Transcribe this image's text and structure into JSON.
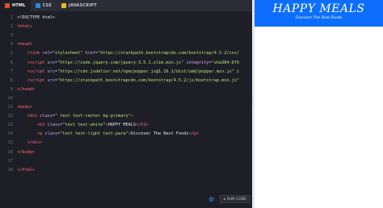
{
  "tabs": [
    {
      "label": "HTML",
      "active": true
    },
    {
      "label": "CSS",
      "active": false
    },
    {
      "label": "JAVASCRIPT",
      "active": false
    }
  ],
  "code_lines": [
    {
      "n": "1",
      "parts": [
        [
          "plain",
          "<!DOCTYPE html>"
        ]
      ]
    },
    {
      "n": "2",
      "parts": [
        [
          "tag",
          "<html>"
        ]
      ]
    },
    {
      "n": "3",
      "parts": []
    },
    {
      "n": "4",
      "parts": [
        [
          "tag",
          "<head>"
        ]
      ]
    },
    {
      "n": "5",
      "parts": [
        [
          "plain",
          "    "
        ],
        [
          "tag",
          "<link "
        ],
        [
          "attr",
          "rel="
        ],
        [
          "str",
          "\"stylesheet\""
        ],
        [
          "attr",
          " href="
        ],
        [
          "str",
          "\"https://stackpath.bootstrapcdn.com/bootstrap/4.5.2/css/"
        ]
      ]
    },
    {
      "n": "6",
      "parts": [
        [
          "plain",
          "    "
        ],
        [
          "tag",
          "<script "
        ],
        [
          "attr",
          "src="
        ],
        [
          "str",
          "\"https://code.jquery.com/jquery-3.5.1.slim.min.js\""
        ],
        [
          "attr",
          " integrity="
        ],
        [
          "str",
          "\"sha384-DfX"
        ]
      ]
    },
    {
      "n": "7",
      "parts": [
        [
          "plain",
          "    "
        ],
        [
          "tag",
          "<script "
        ],
        [
          "attr",
          "src="
        ],
        [
          "str",
          "\"https://cdn.jsdelivr.net/npm/popper.js@1.16.1/dist/umd/popper.min.js\" i"
        ]
      ]
    },
    {
      "n": "8",
      "parts": [
        [
          "plain",
          "    "
        ],
        [
          "tag",
          "<script "
        ],
        [
          "attr",
          "src="
        ],
        [
          "str",
          "\"https://stackpath.bootstrapcdn.com/bootstrap/4.5.2/js/bootstrap.min.js\""
        ]
      ]
    },
    {
      "n": "9",
      "parts": [
        [
          "tag",
          "</head>"
        ]
      ]
    },
    {
      "n": "10",
      "parts": []
    },
    {
      "n": "11",
      "parts": [
        [
          "tag",
          "<body>"
        ]
      ]
    },
    {
      "n": "12",
      "parts": [
        [
          "plain",
          "    "
        ],
        [
          "tag",
          "<div "
        ],
        [
          "attr",
          "class="
        ],
        [
          "str",
          "\" text text-center bg-primary\""
        ],
        [
          "tag",
          ">"
        ]
      ]
    },
    {
      "n": "13",
      "parts": [
        [
          "plain",
          "        "
        ],
        [
          "tag",
          "<h1 "
        ],
        [
          "attr",
          "class="
        ],
        [
          "str",
          "\"text text-white\""
        ],
        [
          "tag",
          ">"
        ],
        [
          "plain",
          "HAPPY MEALS"
        ],
        [
          "tag",
          "</h1>"
        ]
      ]
    },
    {
      "n": "14",
      "parts": [
        [
          "plain",
          "        "
        ],
        [
          "tag",
          "<p "
        ],
        [
          "attr",
          "class="
        ],
        [
          "str",
          "\"text text-light text-para\""
        ],
        [
          "tag",
          ">"
        ],
        [
          "plain",
          "Discover The Best Foods"
        ],
        [
          "tag",
          "</p>"
        ]
      ]
    },
    {
      "n": "15",
      "parts": [
        [
          "plain",
          "    "
        ],
        [
          "tag",
          "</div>"
        ]
      ]
    },
    {
      "n": "16",
      "parts": [
        [
          "tag",
          "</body>"
        ]
      ]
    },
    {
      "n": "17",
      "parts": []
    },
    {
      "n": "18",
      "parts": [
        [
          "tag",
          "</html>"
        ]
      ]
    }
  ],
  "footer": {
    "settings_icon": "gear-icon",
    "run_label": "▸ RUN CODE"
  },
  "preview": {
    "title": "HAPPY MEALS",
    "subtitle": "Discover The Best Foods"
  },
  "colors": {
    "editor_bg": "#1e1f26",
    "tag": "#ff6a7a",
    "attr": "#cfa7ff",
    "string": "#b7e07a",
    "banner": "#0d6efd"
  }
}
